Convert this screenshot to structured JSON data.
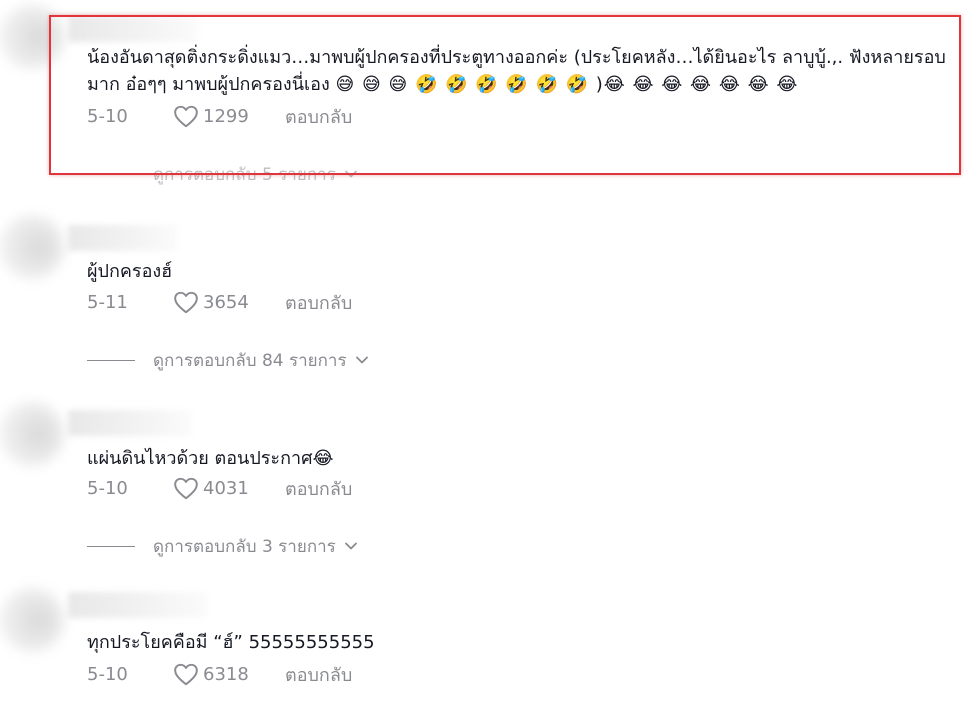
{
  "comments": [
    {
      "text": "น้องอันดาสุดติ่งกระดิ่งแมว…มาพบผู้ปกครองที่ประตูทางออกค่ะ (ประโยคหลัง…ได้ยินอะไร ลาบูบู้.,. ฟังหลายรอบมาก อ๋อๆๆ มาพบผู้ปกครองนี่เอง",
      "emojis": "😅 😅 😅 🤣 🤣 🤣 🤣 🤣 🤣 )😂 😂 😂 😂 😂 😂 😂",
      "date": "5-10",
      "likes": "1299",
      "reply_label": "ตอบกลับ",
      "view_replies": "ดูการตอบกลับ 5 รายการ"
    },
    {
      "text": "ผู้ปกครองฮ์",
      "date": "5-11",
      "likes": "3654",
      "reply_label": "ตอบกลับ",
      "view_replies": "ดูการตอบกลับ 84 รายการ"
    },
    {
      "text": "แผ่นดินไหวด้วย ตอนประกาศ😂",
      "date": "5-10",
      "likes": "4031",
      "reply_label": "ตอบกลับ",
      "view_replies": "ดูการตอบกลับ 3 รายการ"
    },
    {
      "text": "ทุกประโยคคือมี “ฮ์” 55555555555",
      "date": "5-10",
      "likes": "6318",
      "reply_label": "ตอบกลับ"
    }
  ],
  "colors": {
    "text": "#161823",
    "muted": "#8a8b91",
    "highlight": "#e0353b"
  },
  "icons": {
    "like": "heart-outline-icon",
    "expand": "chevron-down-icon"
  }
}
